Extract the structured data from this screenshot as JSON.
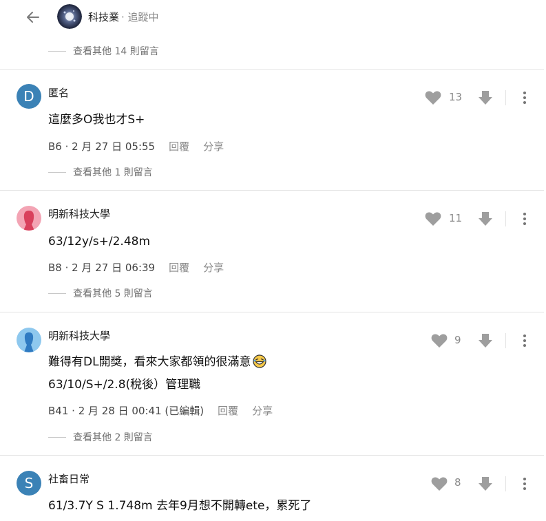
{
  "header": {
    "forum_title": "科技業",
    "status": "· 追蹤中"
  },
  "colors": {
    "anon_avatar": "#3b82b6",
    "pink_avatar": "#f3a4b4",
    "blue_avatar": "#8ec8ee",
    "icon_gray": "#9e9e9e"
  },
  "top_more_replies": "查看其他 14 則留言",
  "comments": [
    {
      "avatar_letter": "D",
      "user": "匿名",
      "lines": [
        "這麼多O我也才S+"
      ],
      "floor": "B6",
      "time": "· 2 月 27 日 05:55",
      "reply": "回覆",
      "share": "分享",
      "likes": "13",
      "more_replies": "查看其他 1 則留言"
    },
    {
      "avatar_icon": "female-avatar-icon",
      "user": "明新科技大學",
      "lines": [
        "63/12y/s+/2.48m"
      ],
      "floor": "B8",
      "time": "· 2 月 27 日 06:39",
      "reply": "回覆",
      "share": "分享",
      "likes": "11",
      "more_replies": "查看其他 5 則留言"
    },
    {
      "avatar_icon": "male-avatar-icon",
      "user": "明新科技大學",
      "lines": [
        "難得有DL開獎，看來大家都領的很滿意",
        "63/10/S+/2.8(稅後）管理職"
      ],
      "floor": "B41",
      "time": "· 2 月 28 日 00:41 (已編輯)",
      "reply": "回覆",
      "share": "分享",
      "likes": "9",
      "more_replies": "查看其他 2 則留言"
    },
    {
      "avatar_letter": "S",
      "user": "社畜日常",
      "lines": [
        "61/3.7Y S 1.748m 去年9月想不開轉ete，累死了"
      ],
      "likes": "8"
    }
  ]
}
